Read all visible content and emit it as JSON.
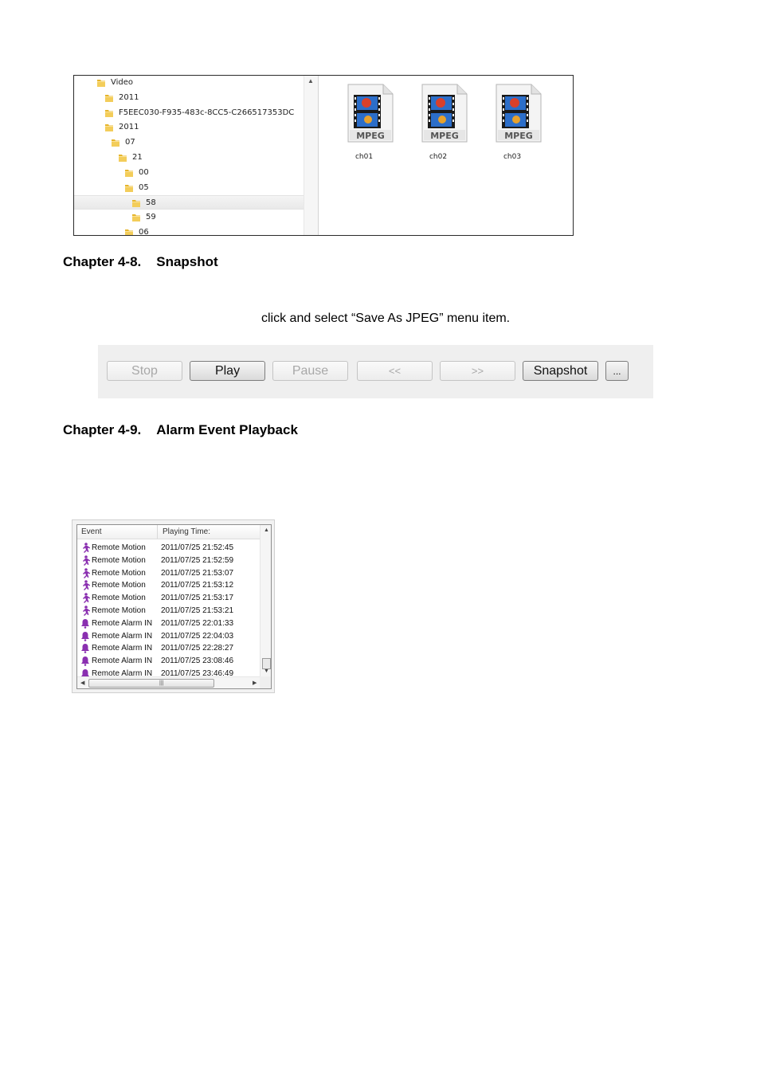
{
  "explorer": {
    "tree": [
      {
        "label": "Video",
        "indent": 0
      },
      {
        "label": "2011",
        "indent": 1
      },
      {
        "label": "F5EEC030-F935-483c-8CC5-C266517353DC",
        "indent": 1
      },
      {
        "label": "2011",
        "indent": 2
      },
      {
        "label": "07",
        "indent": 3
      },
      {
        "label": "21",
        "indent": 4
      },
      {
        "label": "00",
        "indent": 5
      },
      {
        "label": "05",
        "indent": 5
      },
      {
        "label": "58",
        "indent": 6,
        "selected": true
      },
      {
        "label": "59",
        "indent": 6
      },
      {
        "label": "06",
        "indent": 5
      }
    ],
    "files": [
      {
        "name": "ch01",
        "badge": "MPEG"
      },
      {
        "name": "ch02",
        "badge": "MPEG"
      },
      {
        "name": "ch03",
        "badge": "MPEG"
      }
    ]
  },
  "sections": {
    "snapshot": {
      "number": "Chapter 4-8.",
      "title": "Snapshot"
    },
    "alarm": {
      "number": "Chapter 4-9.",
      "title": "Alarm Event Playback"
    }
  },
  "body_text": "click and select “Save As JPEG” menu item.",
  "toolbar": {
    "stop": "Stop",
    "play": "Play",
    "pause": "Pause",
    "rewind": "<<",
    "forward": ">>",
    "snapshot": "Snapshot",
    "more": "..."
  },
  "event_list": {
    "columns": [
      "Event",
      "Playing Time:"
    ],
    "rows": [
      {
        "event": "Remote Motion",
        "time": "2011/07/25 21:52:45",
        "icon": "motion-icon"
      },
      {
        "event": "Remote Motion",
        "time": "2011/07/25 21:52:59",
        "icon": "motion-icon"
      },
      {
        "event": "Remote Motion",
        "time": "2011/07/25 21:53:07",
        "icon": "motion-icon"
      },
      {
        "event": "Remote Motion",
        "time": "2011/07/25 21:53:12",
        "icon": "motion-icon"
      },
      {
        "event": "Remote Motion",
        "time": "2011/07/25 21:53:17",
        "icon": "motion-icon"
      },
      {
        "event": "Remote Motion",
        "time": "2011/07/25 21:53:21",
        "icon": "motion-icon"
      },
      {
        "event": "Remote Alarm IN",
        "time": "2011/07/25 22:01:33",
        "icon": "bell-icon"
      },
      {
        "event": "Remote Alarm IN",
        "time": "2011/07/25 22:04:03",
        "icon": "bell-icon"
      },
      {
        "event": "Remote Alarm IN",
        "time": "2011/07/25 22:28:27",
        "icon": "bell-icon"
      },
      {
        "event": "Remote Alarm IN",
        "time": "2011/07/25 23:08:46",
        "icon": "bell-icon"
      },
      {
        "event": "Remote Alarm IN",
        "time": "2011/07/25 23:46:49",
        "icon": "bell-icon"
      }
    ]
  },
  "colors": {
    "event_icon": "#8a2fb0",
    "folder": "#e8b930"
  }
}
